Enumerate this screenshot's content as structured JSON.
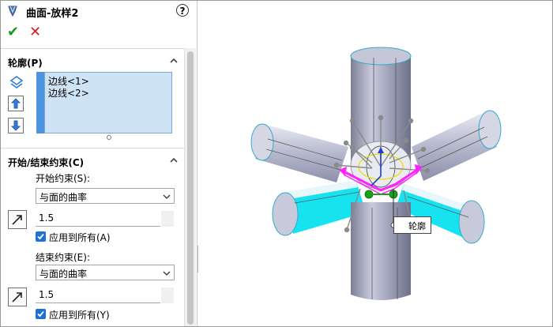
{
  "header": {
    "title": "曲面-放样2",
    "help": "?"
  },
  "actions": {
    "ok": "✔",
    "cancel": "✕"
  },
  "profiles": {
    "heading": "轮廓(P)",
    "items": [
      "边线<1>",
      "边线<2>"
    ]
  },
  "constraints": {
    "heading": "开始/结束约束(C)",
    "start_label": "开始约束(S):",
    "start_value": "与面的曲率",
    "start_tangent": "1.5",
    "start_apply": "应用到所有(A)",
    "end_label": "结束约束(E):",
    "end_value": "与面的曲率",
    "end_tangent": "1.5",
    "end_apply": "应用到所有(Y)"
  },
  "viewport": {
    "callout": "轮廓"
  },
  "colors": {
    "accent": "#4c94e0",
    "selection": "#cfe3f7",
    "highlight_face": "#17e3f0",
    "preview": "#ff22ff",
    "ok": "#1e9b1e",
    "cancel": "#d61d1d"
  }
}
